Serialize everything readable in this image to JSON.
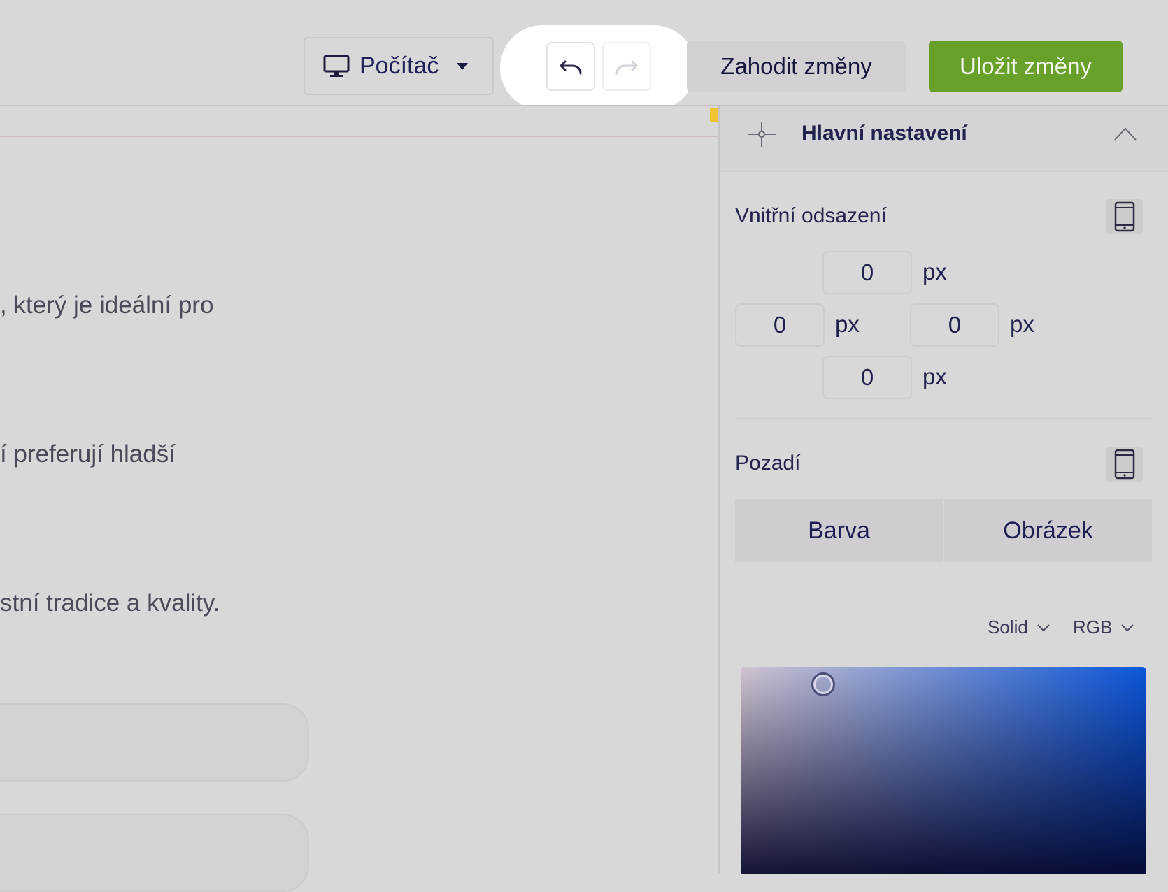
{
  "toolbar": {
    "device_label": "Počítač",
    "discard_label": "Zahodit změny",
    "save_label": "Uložit změny",
    "save_color": "#68a12a"
  },
  "canvas": {
    "lines": [
      ", který je ideální pro",
      "í preferují hladší",
      "stní tradice a kvality."
    ]
  },
  "panel": {
    "title": "Hlavní nastavení",
    "padding": {
      "label": "Vnitřní odsazení",
      "top": "0",
      "left": "0",
      "right": "0",
      "bottom": "0",
      "unit": "px"
    },
    "background": {
      "label": "Pozadí",
      "tabs": [
        "Barva",
        "Obrázek"
      ],
      "fill_mode": "Solid",
      "color_model": "RGB",
      "picker_hue": "#0b56d9"
    }
  },
  "icons": {
    "device": "monitor-icon",
    "dropdown": "caret-down-icon",
    "undo": "undo-icon",
    "redo": "redo-icon",
    "section": "crosshair-icon",
    "collapse": "chevron-up-icon",
    "responsive": "mobile-phone-icon",
    "select": "chevron-down-icon"
  }
}
